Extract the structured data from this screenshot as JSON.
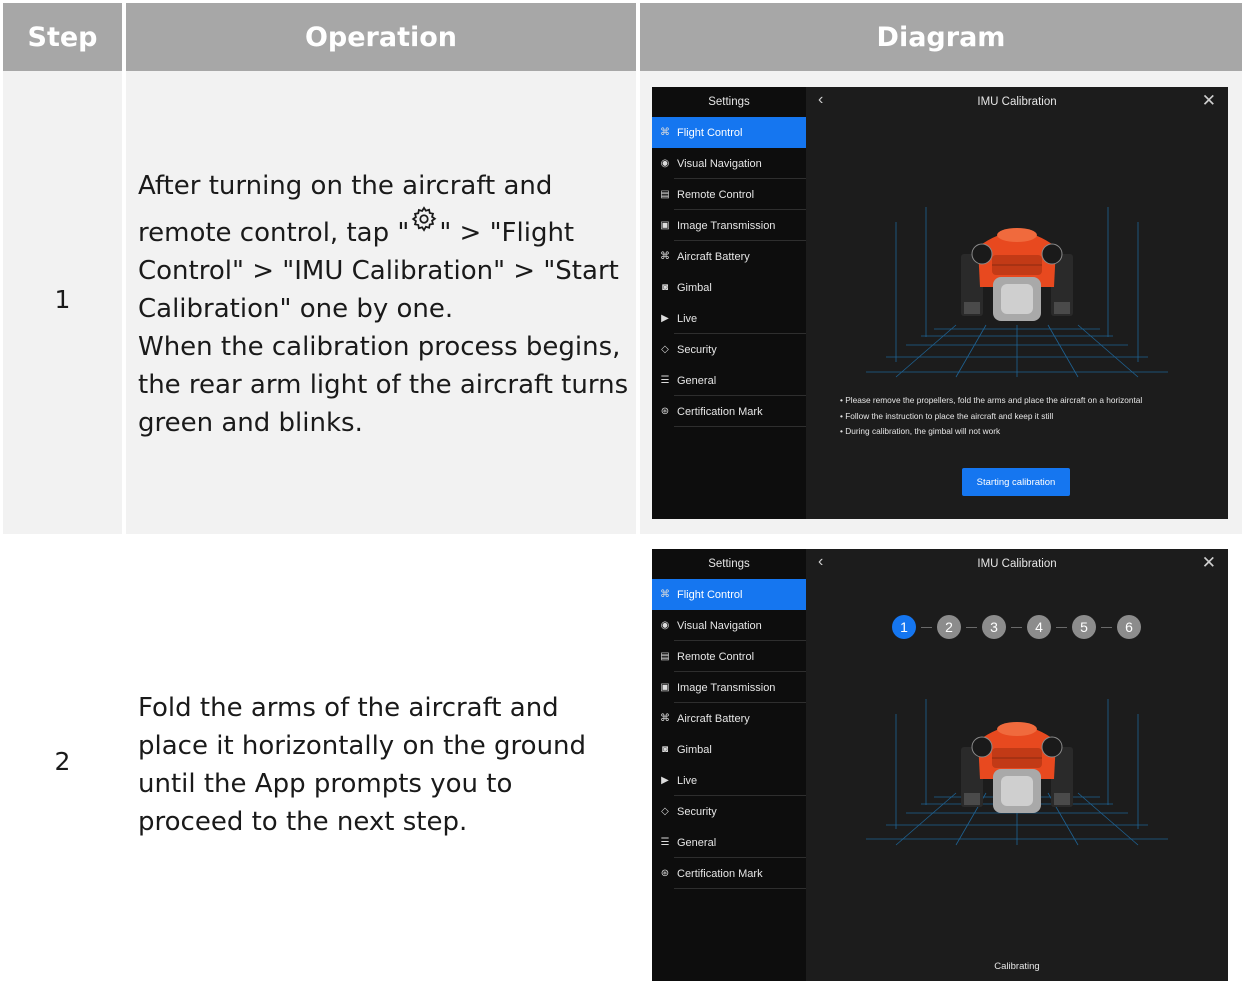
{
  "header": {
    "step": "Step",
    "operation": "Operation",
    "diagram": "Diagram"
  },
  "rows": [
    {
      "step": "1",
      "op_part1": "After turning on the aircraft and remote control, tap \"",
      "op_part2": "\" > \"Flight Control\" > \"IMU Calibration\" > \"Start Calibration\" one by one.",
      "op_para2": "When the calibration process begins, the rear arm light of the aircraft turns green and blinks."
    },
    {
      "step": "2",
      "op_para1": "Fold the arms of the aircraft and place it horizontally on the ground until the App prompts you to proceed to the next step."
    }
  ],
  "app": {
    "sidebar_title": "Settings",
    "menu": [
      {
        "label": "Flight Control",
        "icon": "drone-icon"
      },
      {
        "label": "Visual Navigation",
        "icon": "eye-icon"
      },
      {
        "label": "Remote Control",
        "icon": "remote-icon"
      },
      {
        "label": "Image Transmission",
        "icon": "image-transmission-icon"
      },
      {
        "label": "Aircraft Battery",
        "icon": "battery-icon"
      },
      {
        "label": "Gimbal",
        "icon": "gimbal-icon"
      },
      {
        "label": "Live",
        "icon": "live-icon"
      },
      {
        "label": "Security",
        "icon": "shield-icon"
      },
      {
        "label": "General",
        "icon": "sliders-icon"
      },
      {
        "label": "Certification Mark",
        "icon": "certificate-icon"
      }
    ],
    "title": "IMU Calibration",
    "notes": [
      "Please remove the propellers, fold the arms and place the aircraft on a horizontal",
      "Follow the instruction to place the aircraft and keep it still",
      "During calibration, the gimbal will not work"
    ],
    "start_button": "Starting calibration",
    "calibrating": "Calibrating",
    "steps": [
      "1",
      "2",
      "3",
      "4",
      "5",
      "6"
    ],
    "active_step": 1,
    "colors": {
      "accent": "#1576f0",
      "aircraft": "#e8491f",
      "grid": "#1f6fa8"
    }
  }
}
